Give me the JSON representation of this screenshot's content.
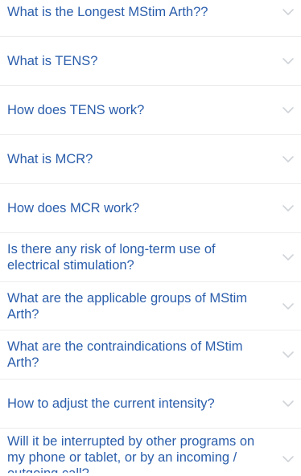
{
  "faq": {
    "items": [
      {
        "question": "What is the Longest MStim Arth??"
      },
      {
        "question": "What is TENS?"
      },
      {
        "question": "How does TENS work?"
      },
      {
        "question": "What is MCR?"
      },
      {
        "question": "How does MCR work?"
      },
      {
        "question": "Is there any risk of long-term use of electrical stimulation?"
      },
      {
        "question": "What are the applicable groups of MStim Arth?"
      },
      {
        "question": "What are the contraindications of MStim Arth?"
      },
      {
        "question": "How to adjust the current intensity?"
      },
      {
        "question": "Will it be interrupted by other programs on my phone or tablet, or by an incoming / outgoing call?"
      }
    ],
    "expand_icon": "chevron-down-icon",
    "colors": {
      "question_text": "#2a5dab",
      "chevron": "#cfd3d8",
      "divider": "#ececec",
      "background": "#ffffff"
    }
  }
}
